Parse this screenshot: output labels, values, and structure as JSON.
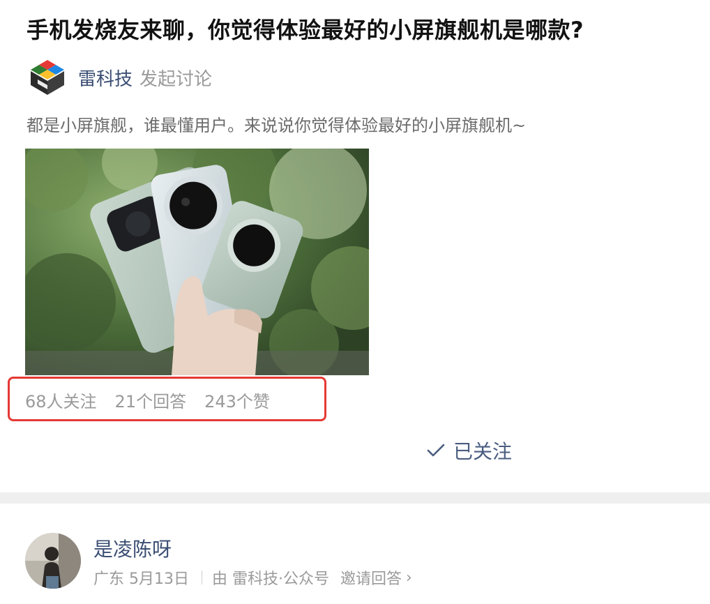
{
  "question": {
    "title": "手机发烧友来聊，你觉得体验最好的小屏旗舰机是哪款?",
    "author": "雷科技",
    "author_action": "发起讨论",
    "description": "都是小屏旗舰，谁最懂用户。来说说你觉得体验最好的小屏旗舰机~"
  },
  "stats": {
    "followers": "68人关注",
    "answers": "21个回答",
    "likes": "243个赞"
  },
  "follow_button": {
    "label": "已关注",
    "icon": "check-icon"
  },
  "answer": {
    "author": "是凌陈呀",
    "location_date": "广东 5月13日",
    "from": "由 雷科技·公众号",
    "invite": "邀请回答",
    "chevron": "›"
  },
  "colors": {
    "link_blue": "#3a4d73",
    "muted": "#9a9a9a",
    "highlight_red": "#e53935"
  }
}
